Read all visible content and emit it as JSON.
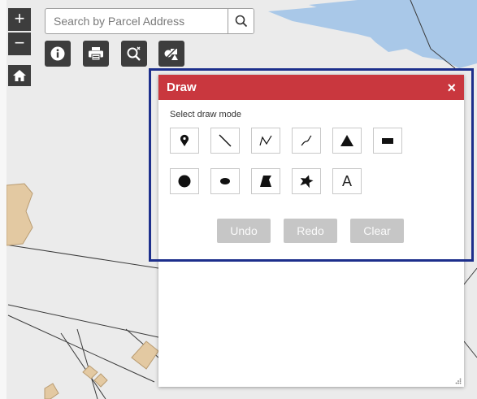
{
  "map": {
    "water_color": "#a9c8e8",
    "parcel_color": "#e3c9a2",
    "line_color": "#3a3a3a"
  },
  "controls": {
    "zoom_in_label": "+",
    "zoom_out_label": "−",
    "home_icon": "home-icon"
  },
  "search": {
    "placeholder": "Search by Parcel Address",
    "value": ""
  },
  "toolbar": {
    "icons": [
      "info-icon",
      "print-icon",
      "zoom-search-icon",
      "draw-icon"
    ]
  },
  "panel": {
    "title": "Draw",
    "close_label": "×",
    "header_color": "#c9373e",
    "mode_label": "Select draw mode",
    "modes": [
      {
        "name": "point",
        "icon": "point-marker-icon"
      },
      {
        "name": "line",
        "icon": "line-icon"
      },
      {
        "name": "polyline",
        "icon": "polyline-icon"
      },
      {
        "name": "freehand-polyline",
        "icon": "freehand-line-icon"
      },
      {
        "name": "triangle",
        "icon": "triangle-icon"
      },
      {
        "name": "rectangle",
        "icon": "rectangle-icon"
      },
      {
        "name": "circle",
        "icon": "circle-icon"
      },
      {
        "name": "ellipse",
        "icon": "ellipse-icon"
      },
      {
        "name": "polygon",
        "icon": "polygon-icon"
      },
      {
        "name": "freehand-polygon",
        "icon": "freehand-polygon-icon"
      },
      {
        "name": "text",
        "icon": "text-icon",
        "label": "A"
      }
    ],
    "actions": {
      "undo": "Undo",
      "redo": "Redo",
      "clear": "Clear"
    }
  },
  "highlight_color": "#1d2f8c"
}
